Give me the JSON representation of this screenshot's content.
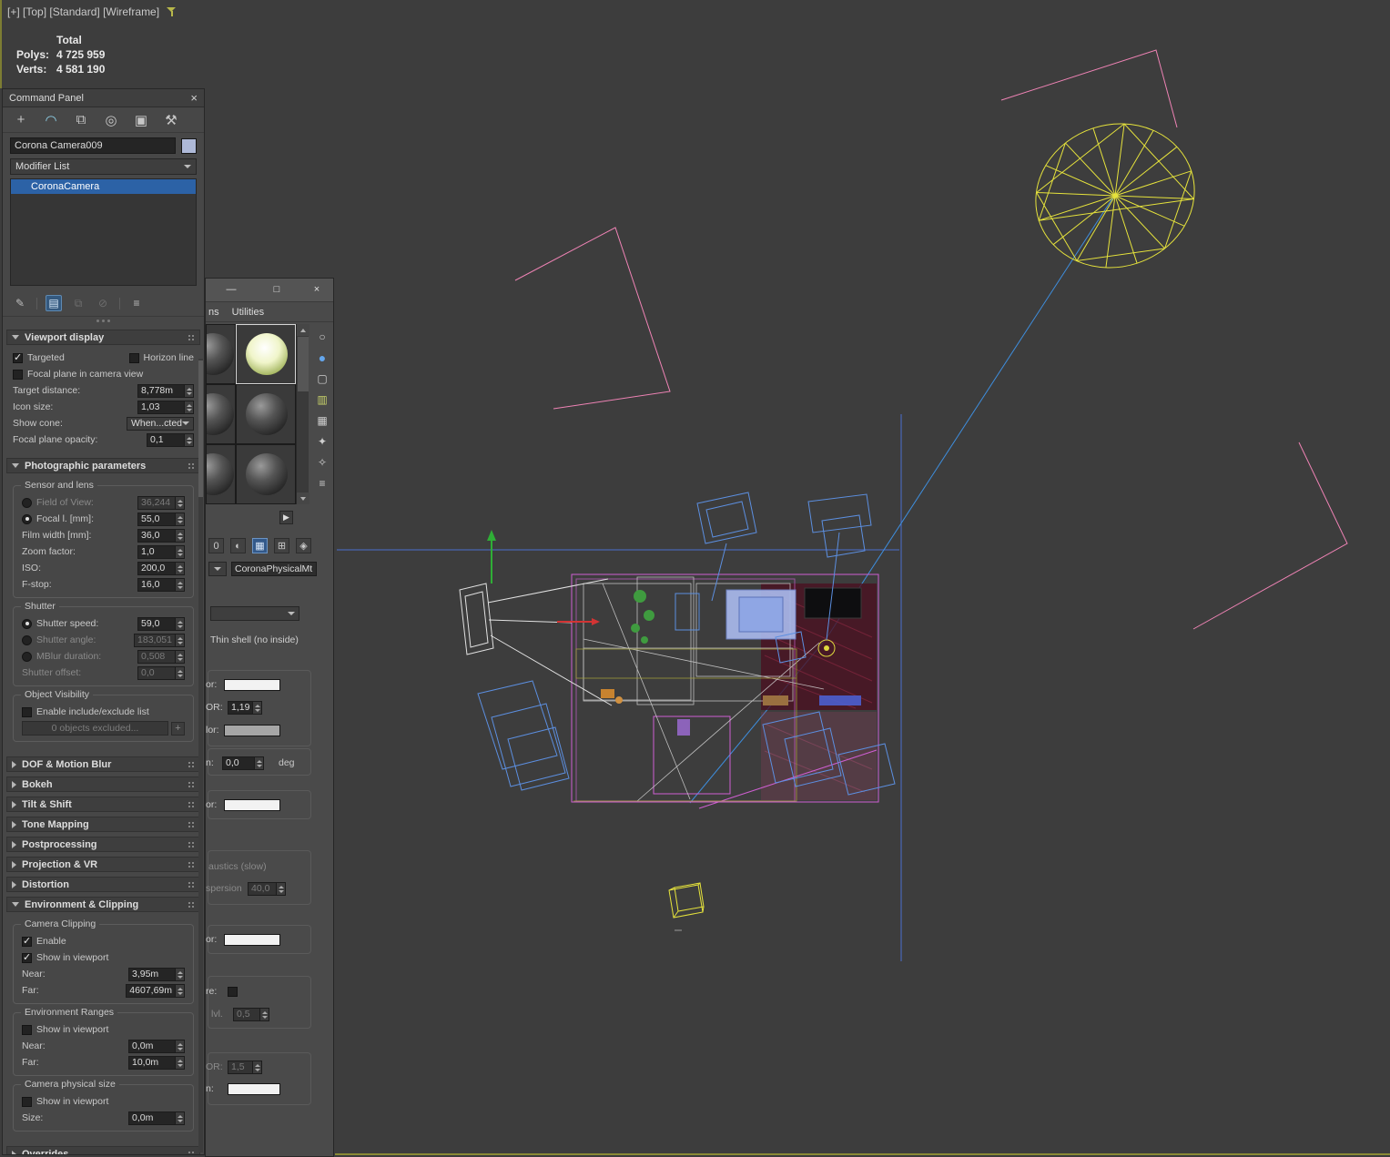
{
  "colors": {
    "viewport_bg": "#3d3d3d",
    "selection_blue": "#2c62a6",
    "wire_yellow": "#e6e33c",
    "wire_pink": "#ef83b5",
    "wire_blue": "#5c8fe0",
    "wire_magenta": "#cf5fd2",
    "target_blue": "#3e8ede"
  },
  "icons": {
    "close": "×",
    "minimize": "—",
    "maximize": "□",
    "create_tab": "+",
    "modify_tab": "◠",
    "hierarchy_tab": "⧉",
    "motion_tab": "◎",
    "display_tab": "▣",
    "utilities_tab": "⚒",
    "pin_stack": "✎",
    "show_end_result": "▤",
    "make_unique": "⧉",
    "remove_modifier": "⊘",
    "configure_sets": "≡",
    "sample_sphere": "○",
    "sample_sphere_active": "●",
    "sample_box": "▢",
    "sample_bars": "▥",
    "sample_checker": "▦",
    "star_a": "✦",
    "star_b": "✧",
    "list": "≡",
    "slot_nav": "▶",
    "backlight": "◐",
    "show_in_viewport": "▦",
    "options": "⊞",
    "pick_material": "◈",
    "plus_small": "+"
  },
  "viewport": {
    "label": "[+] [Top] [Standard] [Wireframe]",
    "stats": {
      "total": "Total",
      "polys_label": "Polys:",
      "polys": "4 725 959",
      "verts_label": "Verts:",
      "verts": "4 581 190"
    }
  },
  "command_panel": {
    "title": "Command Panel",
    "object_name": "Corona Camera009",
    "modifier_list": "Modifier List",
    "stack_item": "CoronaCamera",
    "viewport_display": {
      "title": "Viewport display",
      "targeted": "Targeted",
      "horizon": "Horizon line",
      "focal_plane": "Focal plane in camera view",
      "target_distance_label": "Target distance:",
      "target_distance": "8,778m",
      "icon_size_label": "Icon size:",
      "icon_size": "1,03",
      "show_cone_label": "Show cone:",
      "show_cone": "When...cted",
      "focal_opacity_label": "Focal plane opacity:",
      "focal_opacity": "0,1"
    },
    "photo": {
      "title": "Photographic parameters",
      "sensor_group": "Sensor and lens",
      "fov_label": "Field of View:",
      "fov": "36,244",
      "focal_label": "Focal l. [mm]:",
      "focal": "55,0",
      "film_label": "Film width [mm]:",
      "film": "36,0",
      "zoom_label": "Zoom factor:",
      "zoom": "1,0",
      "iso_label": "ISO:",
      "iso": "200,0",
      "fstop_label": "F-stop:",
      "fstop": "16,0",
      "shutter_group": "Shutter",
      "speed_label": "Shutter speed:",
      "speed": "59,0",
      "angle_label": "Shutter angle:",
      "angle": "183,051",
      "mblur_label": "MBlur duration:",
      "mblur": "0,508",
      "offset_label": "Shutter offset:",
      "offset": "0,0",
      "vis_group": "Object Visibility",
      "enable_list": "Enable include/exclude list",
      "excluded_button": "0 objects excluded..."
    },
    "collapsed": {
      "dof": "DOF & Motion Blur",
      "bokeh": "Bokeh",
      "tilt": "Tilt & Shift",
      "tone": "Tone Mapping",
      "post": "Postprocessing",
      "projection": "Projection & VR",
      "distortion": "Distortion",
      "overrides": "Overrides"
    },
    "env": {
      "title": "Environment & Clipping",
      "clip_group": "Camera Clipping",
      "enable": "Enable",
      "show_vp": "Show in viewport",
      "near_label": "Near:",
      "near": "3,95m",
      "far_label": "Far:",
      "far": "4607,69m",
      "ranges_group": "Environment Ranges",
      "ranges_show": "Show in viewport",
      "ranges_near_label": "Near:",
      "ranges_near": "0,0m",
      "ranges_far_label": "Far:",
      "ranges_far": "10,0m",
      "size_group": "Camera physical size",
      "size_show": "Show in viewport",
      "size_label": "Size:",
      "size": "0,0m"
    }
  },
  "material_editor": {
    "menu_partial": "ns",
    "menu_utilities": "Utilities",
    "slot_id": "0",
    "material_name": "CoronaPhysicalMt",
    "thin_shell_note": "Thin shell (no inside)",
    "rows": {
      "color1_label": "or:",
      "ior1_label": "OR:",
      "ior1_value": "1,19",
      "color2_label": "lor:",
      "rotation_label": "n:",
      "rotation_value": "0,0",
      "deg_label": "deg",
      "color3_label": "or:",
      "caustics_label": "austics (slow)",
      "dispersion_label": "spersion",
      "dispersion_value": "40,0",
      "color4_label": "or:",
      "re_label": "re:",
      "lvl_label": "lvl.",
      "lvl_value": "0,5",
      "ior2_label": "OR:",
      "ior2_value": "1,5",
      "color5_label": "n:"
    }
  }
}
